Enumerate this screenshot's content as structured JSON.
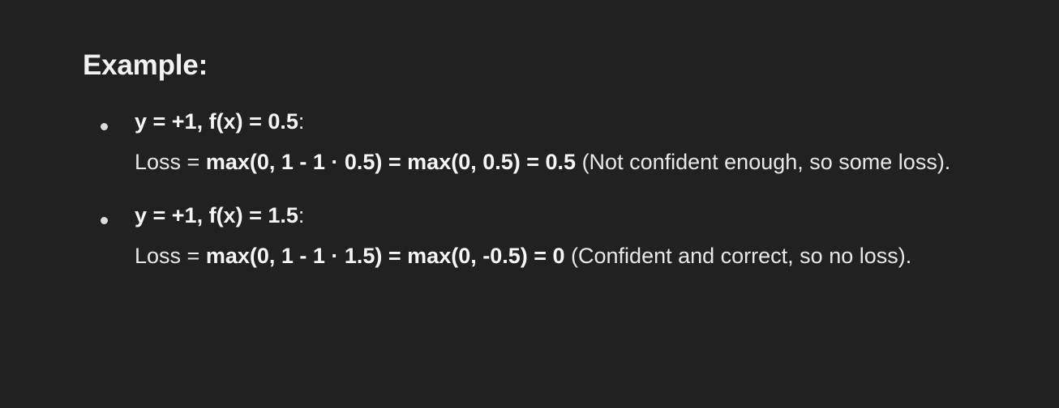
{
  "heading": "Example:",
  "items": [
    {
      "condition": "y = +1, f(x) = 0.5",
      "colon": ":",
      "loss_prefix": "Loss = ",
      "loss_formula": "max(0, 1 - 1 · 0.5) = max(0, 0.5) = 0.5",
      "explanation": " (Not confident enough, so some loss)."
    },
    {
      "condition": "y = +1, f(x) = 1.5",
      "colon": ":",
      "loss_prefix": "Loss = ",
      "loss_formula": "max(0, 1 - 1 · 1.5) = max(0, -0.5) = 0",
      "explanation": " (Confident and correct, so no loss)."
    }
  ]
}
